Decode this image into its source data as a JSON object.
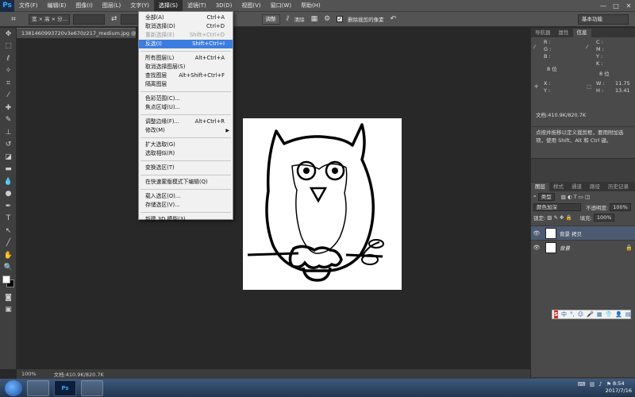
{
  "app": {
    "logo": "Ps"
  },
  "menubar": {
    "items": [
      {
        "label": "文件(F)"
      },
      {
        "label": "编辑(E)"
      },
      {
        "label": "图像(I)"
      },
      {
        "label": "图层(L)"
      },
      {
        "label": "文字(Y)"
      },
      {
        "label": "选择(S)"
      },
      {
        "label": "滤镜(T)"
      },
      {
        "label": "3D(D)"
      },
      {
        "label": "视图(V)"
      },
      {
        "label": "窗口(W)"
      },
      {
        "label": "帮助(H)"
      }
    ],
    "window_controls": [
      "—",
      "□",
      "✕"
    ]
  },
  "options": {
    "style_value": "宽 × 高 × 分...",
    "refine_button": "调整",
    "front_label": "前面的图像",
    "clear_label": "清除",
    "delete_crop_label": "删除裁剪的像素",
    "workspace": "基本功能"
  },
  "document": {
    "tab_title": "1381460993720v3e670z217_medium.jpg @ 100...",
    "zoom": "100%",
    "doc_size": "文档:410.9K/820.7K"
  },
  "select_menu": {
    "groups": [
      [
        {
          "label": "全部(A)",
          "shortcut": "Ctrl+A"
        },
        {
          "label": "取消选择(D)",
          "shortcut": "Ctrl+D"
        },
        {
          "label": "重新选择(E)",
          "shortcut": "Shift+Ctrl+D",
          "disabled": true
        },
        {
          "label": "反选(I)",
          "shortcut": "Shift+Ctrl+I",
          "highlight": true
        }
      ],
      [
        {
          "label": "所有图层(L)",
          "shortcut": "Alt+Ctrl+A"
        },
        {
          "label": "取消选择图层(S)",
          "shortcut": ""
        },
        {
          "label": "查找图层",
          "shortcut": "Alt+Shift+Ctrl+F"
        },
        {
          "label": "隔离图层",
          "shortcut": ""
        }
      ],
      [
        {
          "label": "色彩范围(C)...",
          "shortcut": ""
        },
        {
          "label": "焦点区域(U)...",
          "shortcut": ""
        }
      ],
      [
        {
          "label": "调整边缘(F)...",
          "shortcut": "Alt+Ctrl+R"
        },
        {
          "label": "修改(M)",
          "shortcut": "",
          "submenu": true
        }
      ],
      [
        {
          "label": "扩大选取(G)",
          "shortcut": ""
        },
        {
          "label": "选取相似(R)",
          "shortcut": ""
        }
      ],
      [
        {
          "label": "变换选区(T)",
          "shortcut": ""
        }
      ],
      [
        {
          "label": "在快速蒙版模式下编辑(Q)",
          "shortcut": ""
        }
      ],
      [
        {
          "label": "载入选区(O)...",
          "shortcut": ""
        },
        {
          "label": "存储选区(V)...",
          "shortcut": ""
        }
      ],
      [
        {
          "label": "新建 3D 模型(3)",
          "shortcut": ""
        }
      ]
    ]
  },
  "info_panel": {
    "tabs": [
      "导航器",
      "属性",
      "信息"
    ],
    "r": "R :",
    "g": "G :",
    "b": "B :",
    "c": "C :",
    "m": "M :",
    "y": "Y :",
    "k": "K :",
    "bit_left": "8 位",
    "bit_right": "8 位",
    "x": "X :",
    "y_coord": "Y :",
    "w": "W :",
    "h": "H :",
    "w_val": "11.75",
    "h_val": "13.41",
    "doc": "文档:410.9K/820.7K",
    "hint": "点按并拖移以定义裁剪框，要用附加选项，使用 Shift、Alt 和 Ctrl 键。"
  },
  "layers_panel": {
    "tabs": [
      "图层",
      "样式",
      "通道",
      "路径",
      "历史记录"
    ],
    "kind_filter": "类型",
    "blend_mode": "颜色加深",
    "opacity_label": "不透明度:",
    "opacity": "100%",
    "lock_label": "锁定:",
    "fill_label": "填充:",
    "fill": "100%",
    "layers": [
      {
        "name": "背景 拷贝",
        "selected": true
      },
      {
        "name": "背景",
        "selected": false
      }
    ],
    "footer_icons": [
      "⊘",
      "fx",
      "◧",
      "◐",
      "▭",
      "▣",
      "🗑"
    ]
  },
  "ime": {
    "logo": "S",
    "items": [
      "中",
      "°,",
      "☺",
      "🎤",
      "▦",
      "👕",
      "👤",
      "▤"
    ]
  },
  "taskbar": {
    "apps": [
      "",
      "Ps",
      ""
    ],
    "time": "8:54",
    "date": "2017/7/16"
  }
}
